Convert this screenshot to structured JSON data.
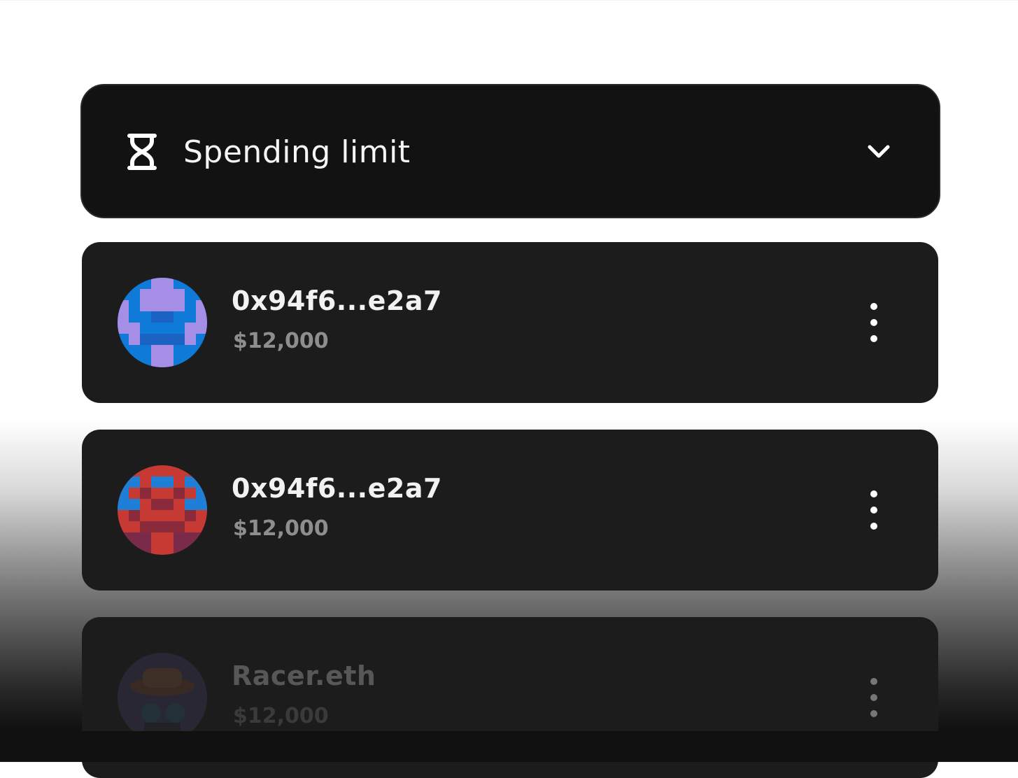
{
  "header": {
    "title": "Spending limit",
    "icon": "hourglass-icon",
    "toggle_icon": "chevron-down-icon"
  },
  "limits": [
    {
      "name": "0x94f6...e2a7",
      "amount": "$12,000",
      "avatar_colors": [
        "#0f7ad8",
        "#a58ee6"
      ]
    },
    {
      "name": "0x94f6...e2a7",
      "amount": "$12,000",
      "avatar_colors": [
        "#c63a33",
        "#1f7fd6",
        "#7a2b4a"
      ]
    },
    {
      "name": "Racer.eth",
      "amount": "$12,000",
      "avatar_colors": [
        "#5a4a6a",
        "#3b2a22"
      ]
    }
  ],
  "colors": {
    "card": "#1c1c1c",
    "header": "#121212",
    "text_primary": "#f2f2f2",
    "text_secondary": "#8e8e8e"
  }
}
